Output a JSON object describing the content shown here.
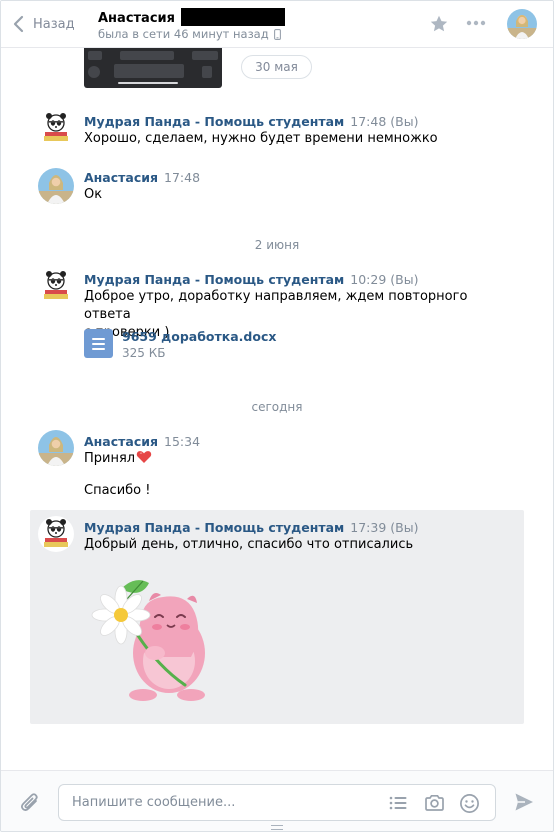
{
  "header": {
    "back_label": "Назад",
    "peer_name": "Анастасия",
    "peer_status": "была в сети 46 минут назад"
  },
  "history": {
    "date_pill": "30 мая",
    "date_2": "2 июня",
    "date_3": "сегодня",
    "messages": [
      {
        "author": "Мудрая Панда - Помощь студентам",
        "time": "17:48 (Вы)",
        "text": "Хорошо, сделаем, нужно будет времени немножко"
      },
      {
        "author": "Анастасия",
        "time": "17:48",
        "text": "Ок"
      },
      {
        "author": "Мудрая Панда - Помощь студентам",
        "time": "10:29 (Вы)",
        "text_line1": "Доброе утро, доработку направляем, ждем повторного ответа",
        "text_line2": "с проверки )",
        "doc_name": "9659 доработка.docx",
        "doc_size": "325 КБ"
      },
      {
        "author": "Анастасия",
        "time": "15:34",
        "text_line1": "Принял",
        "text_line2": "Спасибо !"
      },
      {
        "author": "Мудрая Панда - Помощь студентам",
        "time": "17:39 (Вы)",
        "text": "Добрый день, отлично, спасибо что отписались"
      }
    ]
  },
  "composer": {
    "placeholder": "Напишите сообщение..."
  },
  "colors": {
    "link": "#2a5885",
    "muted": "#818c99",
    "selected_bg": "#edeef0",
    "doc_icon": "#6f9ad3",
    "heart": "#e64646"
  },
  "icons": [
    "chevron-left-icon",
    "phone-icon",
    "star-icon",
    "more-icon",
    "paperclip-icon",
    "templates-icon",
    "camera-icon",
    "emoji-icon",
    "send-icon",
    "doc-icon",
    "heart-emoji"
  ]
}
